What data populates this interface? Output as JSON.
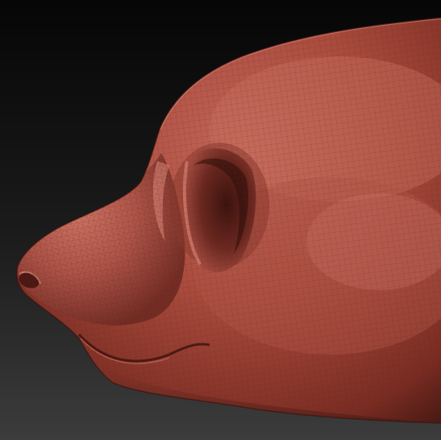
{
  "scene": {
    "subject": "sculpted-head-profile-render",
    "colors": {
      "background_top": "#060606",
      "background_bottom": "#3c3c3c",
      "clay_base": "#a84a3c",
      "clay_highlight": "#d27a6a",
      "clay_shadow": "#4a1a14",
      "wire": "#6e2a22"
    }
  }
}
